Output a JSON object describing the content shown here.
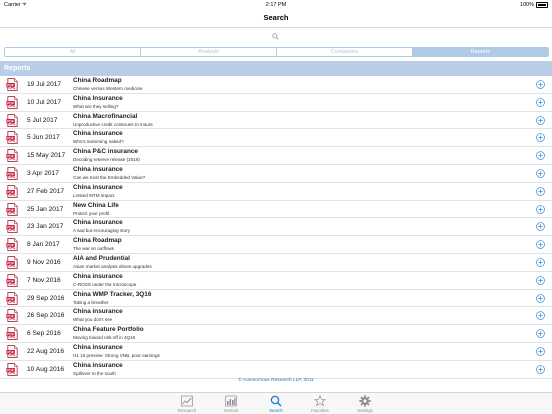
{
  "status_bar": {
    "carrier": "Carrier",
    "time": "2:17 PM",
    "battery": "100%"
  },
  "nav": {
    "title": "Search"
  },
  "segments": [
    {
      "label": "All",
      "active": false
    },
    {
      "label": "Analysis",
      "active": false
    },
    {
      "label": "Companies",
      "active": false
    },
    {
      "label": "Reports",
      "active": true
    }
  ],
  "section": {
    "title": "Reports"
  },
  "reports": [
    {
      "date": "19 Jul 2017",
      "title": "China Roadmap",
      "subtitle": "Chinese versus Western medicine"
    },
    {
      "date": "10 Jul 2017",
      "title": "China Insurance",
      "subtitle": "What are they selling?"
    },
    {
      "date": "5 Jul 2017",
      "title": "China Macrofinancial",
      "subtitle": "Unproductive credit continues to mount"
    },
    {
      "date": "5 Jun 2017",
      "title": "China insurance",
      "subtitle": "Who's swimming naked?"
    },
    {
      "date": "15 May 2017",
      "title": "China P&C insurance",
      "subtitle": "Decoding reserve release (2016)"
    },
    {
      "date": "3 Apr 2017",
      "title": "China insurance",
      "subtitle": "Can we trust the Embedded Value?"
    },
    {
      "date": "27 Feb 2017",
      "title": "China insurance",
      "subtitle": "Limited MTM impact"
    },
    {
      "date": "25 Jan 2017",
      "title": "New China Life",
      "subtitle": "Protect your profit"
    },
    {
      "date": "23 Jan 2017",
      "title": "China insurance",
      "subtitle": "A sad but encouraging story"
    },
    {
      "date": "8 Jan 2017",
      "title": "China Roadmap",
      "subtitle": "The war on outflows"
    },
    {
      "date": "9 Nov 2016",
      "title": "AIA and Prudential",
      "subtitle": "Asian market analysis drives upgrades"
    },
    {
      "date": "7 Nov 2016",
      "title": "China insurance",
      "subtitle": "C-ROSS under the microscope"
    },
    {
      "date": "29 Sep 2016",
      "title": "China WMP Tracker, 3Q16",
      "subtitle": "Taking a breather"
    },
    {
      "date": "26 Sep 2016",
      "title": "China insurance",
      "subtitle": "What you don't see"
    },
    {
      "date": "6 Sep 2016",
      "title": "China Feature Portfolio",
      "subtitle": "Moving toward risk-off in 4Q16"
    },
    {
      "date": "22 Aug 2016",
      "title": "China insurance",
      "subtitle": "H1 16 preview: Strong VNB, poor earnings"
    },
    {
      "date": "10 Aug 2016",
      "title": "China insurance",
      "subtitle": "Spillover to the south"
    }
  ],
  "footer": {
    "copyright": "© Autonomous Research LLP, 2011"
  },
  "tabs": [
    {
      "label": "Research",
      "icon": "research-chart-icon",
      "active": false
    },
    {
      "label": "Sectors",
      "icon": "sectors-bar-icon",
      "active": false
    },
    {
      "label": "Search",
      "icon": "search-icon",
      "active": true
    },
    {
      "label": "Favorites",
      "icon": "star-icon",
      "active": false
    },
    {
      "label": "Settings",
      "icon": "gear-icon",
      "active": false
    }
  ],
  "colors": {
    "accent": "#1a7ad8",
    "section_header": "#b9cde6",
    "segment_active": "#b0c9e6",
    "pdf_red": "#c8102e"
  }
}
